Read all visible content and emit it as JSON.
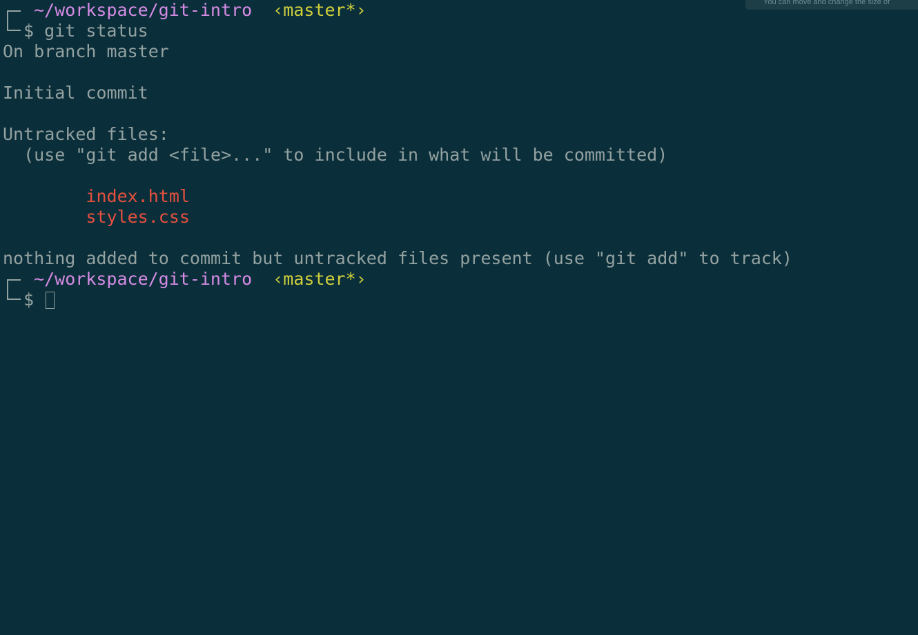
{
  "tooltip": {
    "text": "You can move and change the size of"
  },
  "prompt1": {
    "path": "~/workspace/git-intro",
    "branch": "‹master*›",
    "symbol": "$",
    "command": " git status"
  },
  "output": {
    "branch_line": "On branch master",
    "initial_commit": "Initial commit",
    "untracked_header": "Untracked files:",
    "hint": "  (use \"git add <file>...\" to include in what will be committed)",
    "files": [
      "index.html",
      "styles.css"
    ],
    "summary": "nothing added to commit but untracked files present (use \"git add\" to track)"
  },
  "prompt2": {
    "path": "~/workspace/git-intro",
    "branch": "‹master*›",
    "symbol": "$"
  },
  "colors": {
    "background": "#0b2f3a",
    "text": "#93a1a1",
    "path": "#d58be4",
    "branch": "#cfcf3a",
    "untracked": "#e5503f"
  }
}
